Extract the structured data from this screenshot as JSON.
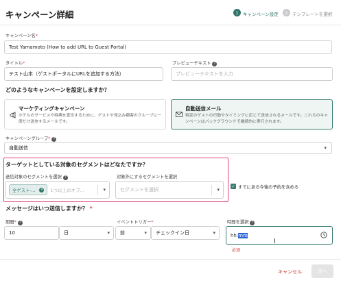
{
  "header": {
    "title": "キャンペーン詳細",
    "steps": [
      {
        "number": "1",
        "label": "キャンペーン設定",
        "active": true
      },
      {
        "number": "2",
        "label": "テンプレートを選択",
        "active": false
      }
    ]
  },
  "campaign_name": {
    "label": "キャンペーン名",
    "required_mark": "*",
    "value": "Test Yamamoto (How to add URL to Guest Portal)"
  },
  "title_field": {
    "label": "タイトル",
    "required_mark": "*",
    "value": "テスト山本（ゲストポータルにURLを追加する方法）"
  },
  "preview_text": {
    "label": "プレビューテキスト",
    "placeholder": "プレビューテキストを入力"
  },
  "campaign_type_section": {
    "title": "どのようなキャンペーンを設定しますか？",
    "options": [
      {
        "title": "マーケティングキャンペーン",
        "description": "ホテルのサービスや特典を宣伝するために、ゲストや見込み顧客のグループに一度だけ送信するメールです。",
        "icon": "megaphone-icon",
        "selected": false
      },
      {
        "title": "自動送信メール",
        "description": "特定のゲストの行動やタイミングに応じて送信されるメールです。これらのキャンペーンはバックグラウンドで継続的に実行されます。",
        "icon": "envelope-icon",
        "selected": true
      }
    ]
  },
  "campaign_group": {
    "label": "キャンペーングループ",
    "required_mark": "*",
    "value": "自動送信"
  },
  "segment_section": {
    "title": "ターゲットとしている対象のセグメントはどなたですか？",
    "include_label": "送信対象のセグメントを選択",
    "include_chip": "全ゲスト-...",
    "include_placeholder": "1つ以上のオブ...",
    "exclude_label": "対象外にするセグメントを選択",
    "exclude_placeholder": "セグメントを選択",
    "future_checkbox_label": "すでにある今後の予約を含める",
    "future_checked": true
  },
  "timing_section": {
    "title": "メッセージはいつ送信しますか？",
    "required_mark": "*",
    "period_label": "期間",
    "period_value": "10",
    "unit_value": "日",
    "trigger_label": "イベントトリガー",
    "trigger_when": "前",
    "trigger_event": "チェックイン日",
    "time_label": "時間を選択",
    "time_value_plain": "hh:",
    "time_value_selected": "mm",
    "time_error": "必須"
  },
  "footer": {
    "cancel_label": "キャンセル",
    "next_label": "次へ"
  },
  "colors": {
    "accent": "#2f7468",
    "highlight": "#e0407a",
    "error": "#d64545",
    "cancel": "#c0392b"
  }
}
